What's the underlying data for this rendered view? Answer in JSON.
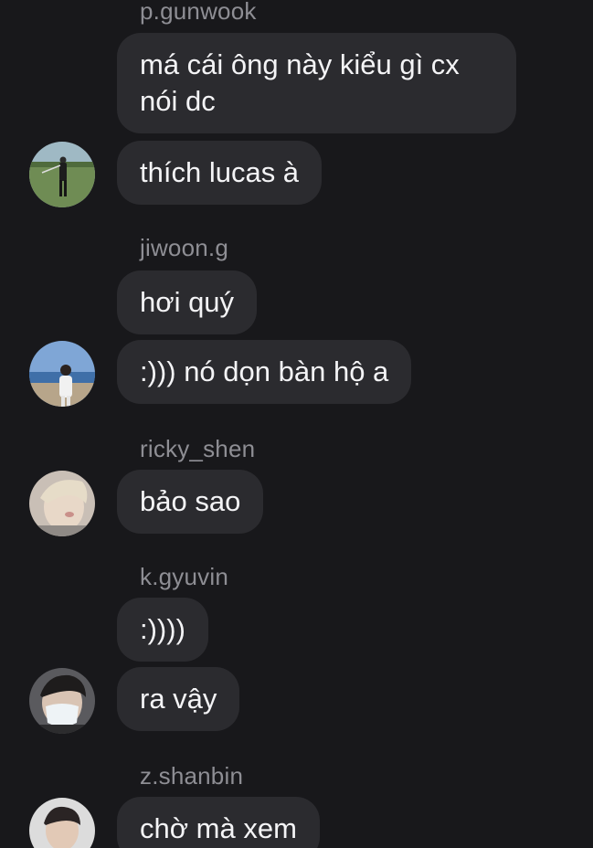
{
  "messages": [
    {
      "sender": "p.gunwook",
      "bubbles": [
        "má cái ông này kiểu gì cx\nnói dc",
        "thích lucas à"
      ],
      "avatar": "golfer-avatar"
    },
    {
      "sender": "jiwoon.g",
      "bubbles": [
        "hơi quý",
        ":))) nó dọn bàn hộ a"
      ],
      "avatar": "beach-avatar"
    },
    {
      "sender": "ricky_shen",
      "bubbles": [
        "bảo sao"
      ],
      "avatar": "blonde-avatar"
    },
    {
      "sender": "k.gyuvin",
      "bubbles": [
        ":))))",
        "ra vậy"
      ],
      "avatar": "mask-avatar"
    },
    {
      "sender": "z.shanbin",
      "bubbles": [
        "chờ mà xem"
      ],
      "avatar": "portrait-avatar"
    }
  ],
  "colors": {
    "background": "#18181b",
    "bubble": "#2b2b2f",
    "sender": "#8e8e94",
    "text": "#f4f4f6"
  }
}
